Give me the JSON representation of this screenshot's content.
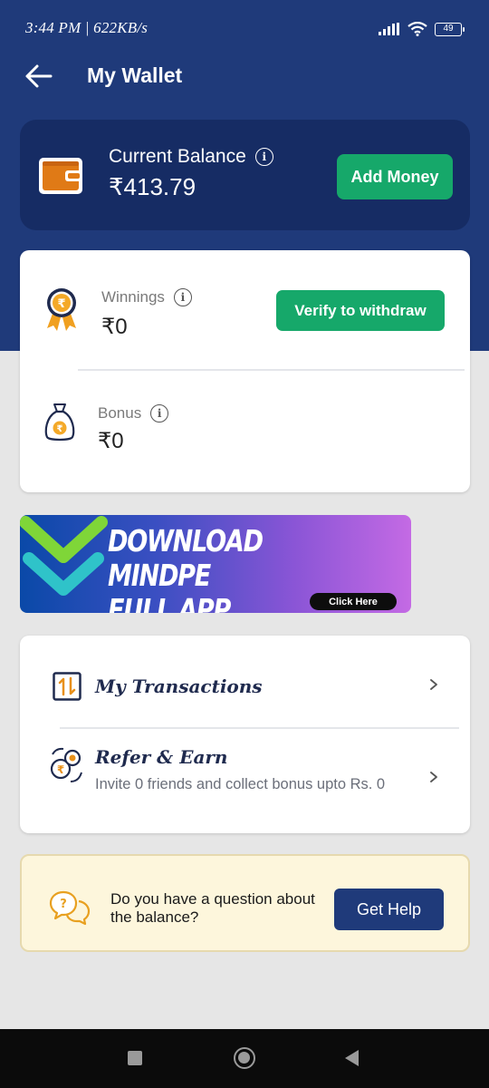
{
  "status_bar": {
    "time": "3:44 PM | 622KB/s",
    "battery": "49",
    "icons": [
      "signal-icon",
      "wifi-icon",
      "battery-icon"
    ]
  },
  "app_bar": {
    "title": "My Wallet",
    "back_icon": "arrow-left-icon"
  },
  "balance": {
    "label": "Current Balance",
    "amount": "₹413.79",
    "add_money_label": "Add Money"
  },
  "winnings": {
    "label": "Winnings",
    "amount": "₹0",
    "verify_label": "Verify to withdraw"
  },
  "bonus": {
    "label": "Bonus",
    "amount": "₹0"
  },
  "banner": {
    "headline": "DOWNLOAD MINDPE\nFULL APP",
    "button_label": "Click Here"
  },
  "menu": {
    "transactions_label": "My Transactions",
    "refer_label": "Refer & Earn",
    "refer_desc": "Invite 0 friends and collect bonus upto Rs. 0"
  },
  "help": {
    "text": "Do you have a question about the balance?",
    "button_label": "Get Help"
  },
  "colors": {
    "header": "#1f3a7a",
    "card_dark": "#162c64",
    "green": "#16a86a",
    "help_bg": "#fdf6dc"
  }
}
